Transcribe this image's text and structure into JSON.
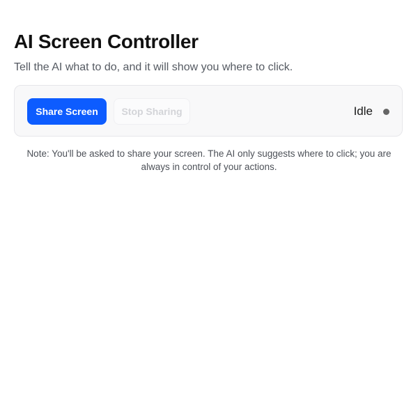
{
  "header": {
    "title": "AI Screen Controller",
    "subtitle": "Tell the AI what to do, and it will show you where to click."
  },
  "controls": {
    "share_label": "Share Screen",
    "stop_label": "Stop Sharing",
    "stop_enabled": false
  },
  "status": {
    "text": "Idle",
    "dot_color": "#666666"
  },
  "note": "Note: You'll be asked to share your screen. The AI only suggests where to click; you are always in control of your actions.",
  "colors": {
    "accent": "#0d5cff",
    "card_background": "#f8f8f9"
  }
}
